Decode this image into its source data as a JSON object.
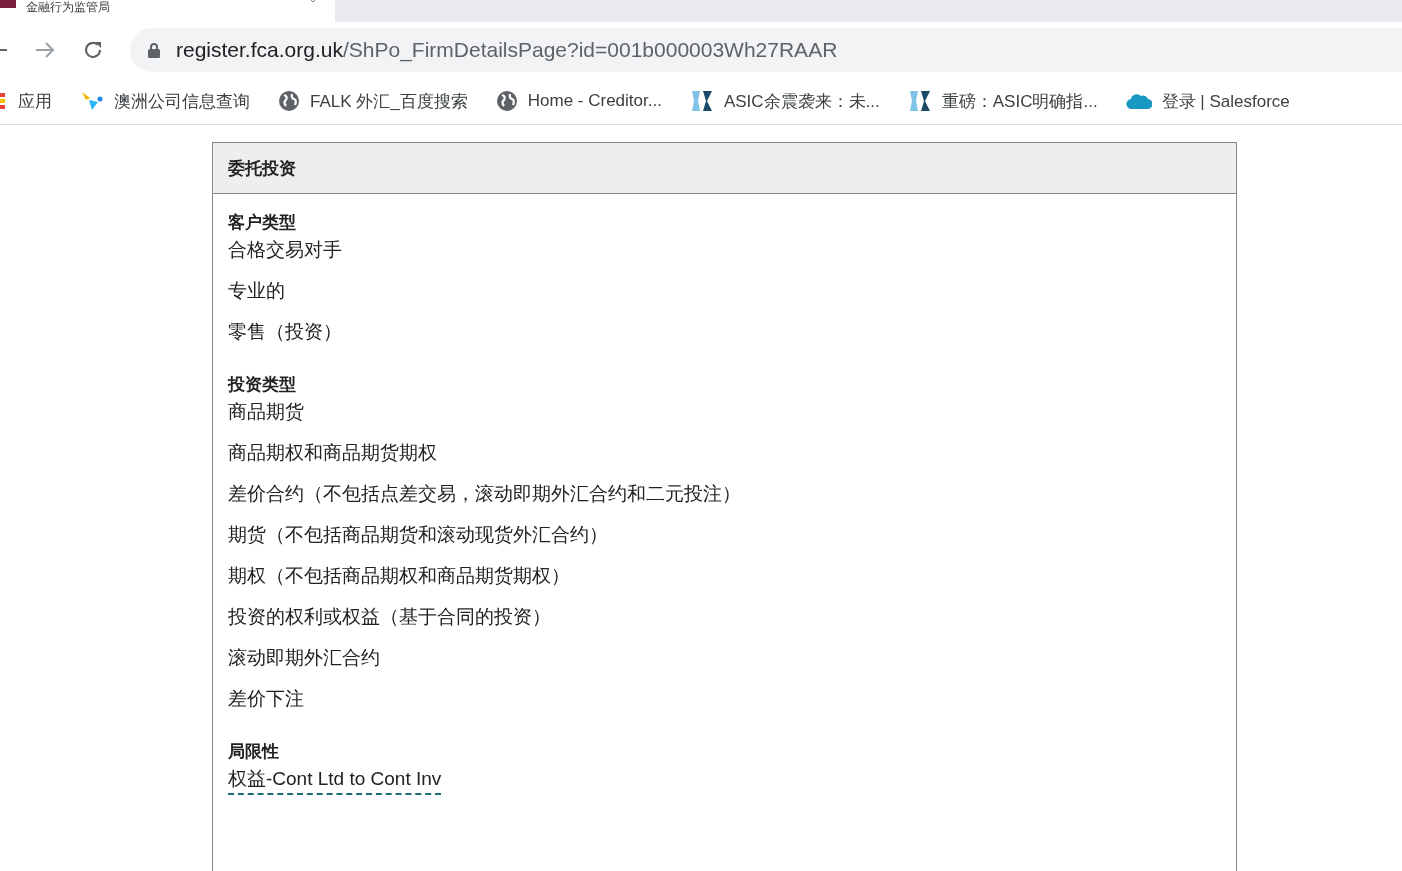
{
  "browser": {
    "tab": {
      "title": "金融行为监管局"
    },
    "address": {
      "host": "register.fca.org.uk",
      "path": "/ShPo_FirmDetailsPage?id=001b000003Wh27RAAR"
    },
    "bookmarks": [
      {
        "kind": "apps",
        "label": "应用"
      },
      {
        "kind": "spark",
        "label": "澳洲公司信息查询"
      },
      {
        "kind": "globe",
        "label": "FALK 外汇_百度搜索"
      },
      {
        "kind": "globe",
        "label": "Home - Creditor..."
      },
      {
        "kind": "fx",
        "label": "ASIC余震袭来：未..."
      },
      {
        "kind": "fx",
        "label": "重磅：ASIC明确指..."
      },
      {
        "kind": "cloud",
        "label": "登录 | Salesforce"
      }
    ]
  },
  "panel": {
    "title": "委托投资",
    "sections": [
      {
        "heading": "客户类型",
        "items": [
          "合格交易对手",
          "专业的",
          "零售（投资）"
        ]
      },
      {
        "heading": "投资类型",
        "items": [
          "商品期货",
          "商品期权和商品期货期权",
          "差价合约（不包括点差交易，滚动即期外汇合约和二元投注）",
          "期货（不包括商品期货和滚动现货外汇合约）",
          "期权（不包括商品期权和商品期货期权）",
          "投资的权利或权益（基于合同的投资）",
          "滚动即期外汇合约",
          "差价下注"
        ]
      },
      {
        "heading": "局限性",
        "link": "权益-Cont Ltd to Cont Inv"
      }
    ]
  }
}
